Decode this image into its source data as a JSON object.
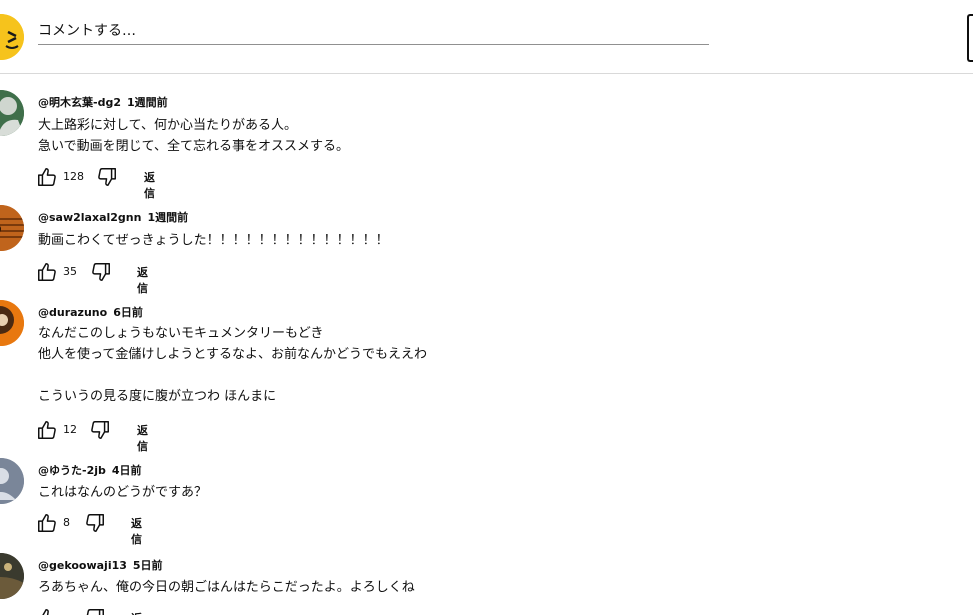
{
  "composer": {
    "placeholder": "コメントする…",
    "avatar_icon": "user-avatar-yellow"
  },
  "comments": [
    {
      "author": "@明木玄葉-dg2",
      "time": "1週間前",
      "lines": [
        "大上路彩に対して、何か心当たりがある人。",
        "急いで動画を閉じて、全て忘れる事をオススメする。"
      ],
      "likes": "128",
      "reply": "返信",
      "avatar_color": "#3f6f4a"
    },
    {
      "author": "@saw2laxal2gnn",
      "time": "1週間前",
      "lines": [
        "動画こわくてぜっきょうした！！！！！！！！！！！！！！"
      ],
      "likes": "35",
      "reply": "返信",
      "avatar_color": "#c0641c"
    },
    {
      "author": "@durazuno",
      "time": "6日前",
      "lines": [
        "なんだこのしょうもないモキュメンタリーもどき",
        "他人を使って金儲けしようとするなよ、お前なんかどうでもええわ",
        "",
        "こういうの見る度に腹が立つわ ほんまに"
      ],
      "likes": "12",
      "reply": "返信",
      "avatar_color": "#e8780f"
    },
    {
      "author": "@ゆうた-2jb",
      "time": "4日前",
      "lines": [
        "これはなんのどうがですあ？"
      ],
      "likes": "8",
      "reply": "返信",
      "avatar_color": "#7a8699"
    },
    {
      "author": "@gekoowaji13",
      "time": "5日前",
      "lines": [
        "ろあちゃん、俺の今日の朝ごはんはたらこだったよ。よろしくね"
      ],
      "likes": "",
      "reply": "返信",
      "avatar_color": "#3a3a2e"
    }
  ]
}
